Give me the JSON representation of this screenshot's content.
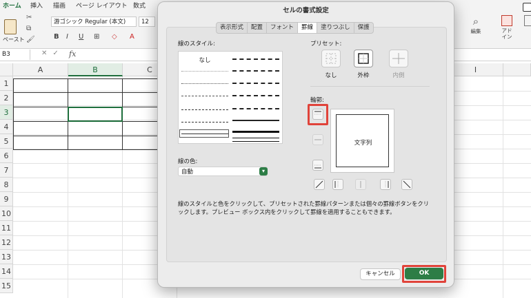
{
  "ribbon": {
    "tabs": [
      "ホーム",
      "挿入",
      "描画",
      "ページ レイアウト",
      "数式"
    ],
    "paste_label": "ペースト",
    "font_name": "游ゴシック Regular (本文)",
    "font_size": "12",
    "edit_label": "編集",
    "addin_label": "アド\nイン"
  },
  "formula": {
    "name_box": "B3",
    "fx": "fx"
  },
  "sheet": {
    "columns": [
      "A",
      "B",
      "C",
      "I"
    ],
    "rows": [
      "1",
      "2",
      "3",
      "4",
      "5",
      "6",
      "7",
      "8",
      "9",
      "10",
      "11",
      "12",
      "13",
      "14",
      "15"
    ]
  },
  "dialog": {
    "title": "セルの書式設定",
    "tabs": [
      "表示形式",
      "配置",
      "フォント",
      "罫線",
      "塗りつぶし",
      "保護"
    ],
    "active_tab": "罫線",
    "line_style_label": "線のスタイル:",
    "none_style": "なし",
    "color_label": "線の色:",
    "color_value": "自動",
    "preset_label": "プリセット:",
    "presets": [
      "なし",
      "外枠",
      "内側"
    ],
    "border_label": "輪郭:",
    "preview_text": "文字列",
    "help_text": "線のスタイルと色をクリックして、プリセットされた罫線パターンまたは個々の罫線ボタンをクリックします。プレビュー ボックス内をクリックして罫線を適用することもできます。",
    "cancel": "キャンセル",
    "ok": "OK",
    "accent_color": "#2d7d46",
    "highlight_color": "#e0433a"
  }
}
